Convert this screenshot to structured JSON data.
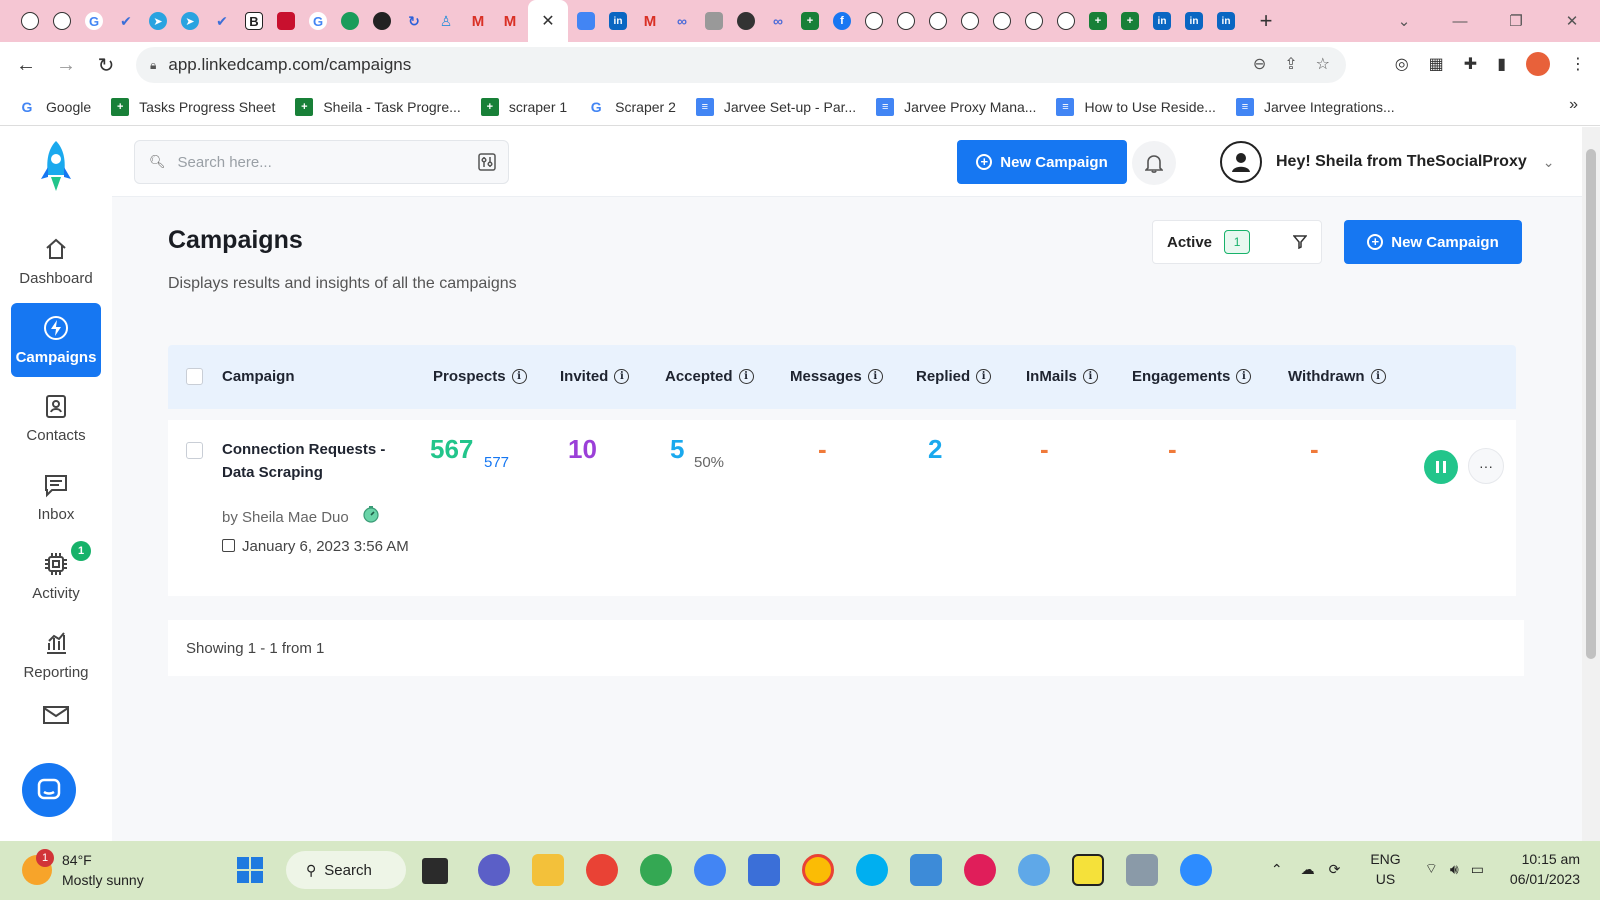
{
  "browser": {
    "active_tab_close": "✕",
    "new_tab": "+",
    "url": "app.linkedcamp.com/campaigns",
    "bookmarks": [
      {
        "label": "Google"
      },
      {
        "label": "Tasks Progress Sheet"
      },
      {
        "label": "Sheila - Task Progre..."
      },
      {
        "label": "scraper 1"
      },
      {
        "label": "Scraper 2"
      },
      {
        "label": "Jarvee Set-up - Par..."
      },
      {
        "label": "Jarvee Proxy Mana..."
      },
      {
        "label": "How to Use Reside..."
      },
      {
        "label": "Jarvee Integrations..."
      }
    ],
    "bookmarks_more": "»"
  },
  "sidebar": {
    "items": [
      {
        "label": "Dashboard"
      },
      {
        "label": "Campaigns"
      },
      {
        "label": "Contacts"
      },
      {
        "label": "Inbox"
      },
      {
        "label": "Activity",
        "badge": "1"
      },
      {
        "label": "Reporting"
      }
    ]
  },
  "topbar": {
    "search_placeholder": "Search here...",
    "new_campaign": "New Campaign",
    "user_greeting": "Hey! Sheila from TheSocialProxy"
  },
  "page": {
    "title": "Campaigns",
    "subtitle": "Displays results and insights of all the campaigns",
    "status_filter": "Active",
    "status_count": "1",
    "new_campaign": "New Campaign"
  },
  "table": {
    "columns": [
      "Campaign",
      "Prospects",
      "Invited",
      "Accepted",
      "Messages",
      "Replied",
      "InMails",
      "Engagements",
      "Withdrawn"
    ],
    "info_glyph": "i",
    "rows": [
      {
        "name": "Connection Requests - Data Scraping",
        "by": "by Sheila Mae Duo",
        "date": "January 6, 2023 3:56 AM",
        "prospects": "567",
        "prospects_total": "577",
        "invited": "10",
        "accepted": "5",
        "accepted_pct": "50%",
        "messages": "-",
        "replied": "2",
        "inmails": "-",
        "engagements": "-",
        "withdrawn": "-"
      }
    ],
    "pager": "Showing 1 - 1 from 1"
  },
  "taskbar": {
    "weather_badge": "1",
    "temp": "84°F",
    "condition": "Mostly sunny",
    "search": "Search",
    "lang": "ENG",
    "region": "US",
    "time": "10:15 am",
    "date": "06/01/2023"
  },
  "colors": {
    "brand_blue": "#1677f2",
    "prospects_green": "#22c58b",
    "invited_purple": "#9b3fd8",
    "accepted_cyan": "#1aa9ee",
    "dash_orange": "#f07a3a",
    "active_green": "#17b26a"
  }
}
